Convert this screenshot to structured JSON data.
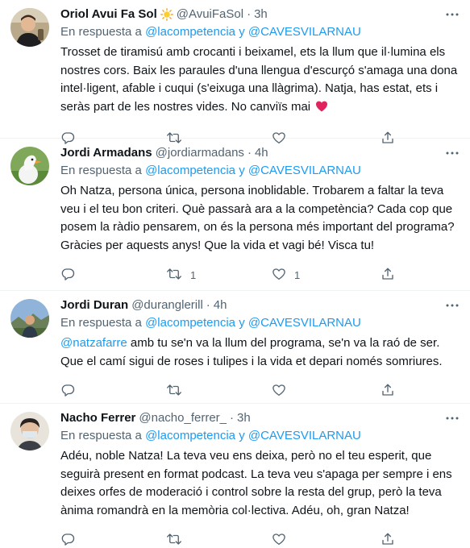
{
  "tweets": [
    {
      "name": "Oriol Avui Fa Sol",
      "has_sun": true,
      "handle": "@AvuiFaSol",
      "dot": "·",
      "time": "3h",
      "reply_prefix": "En respuesta a",
      "reply_link": "@lacompetencia y @CAVESVILARNAU",
      "mention": "",
      "text": "Trosset de tiramisú amb crocanti i beixamel, ets la llum que il·lumina els nostres cors. Baix les paraules d'una llengua d'escurçó s'amaga una dona intel·ligent, afable i cuqui (s'eixuga una llàgrima). Natja, has estat, ets i seràs part de les nostres vides. No canviïs mai",
      "ends_with_heart": true,
      "counts": {
        "reply": "",
        "retweet": "",
        "like": ""
      }
    },
    {
      "name": "Jordi Armadans",
      "has_sun": false,
      "handle": "@jordiarmadans",
      "dot": "·",
      "time": "4h",
      "reply_prefix": "En respuesta a",
      "reply_link": "@lacompetencia y @CAVESVILARNAU",
      "mention": "",
      "text": "Oh Natza, persona única, persona inoblidable. Trobarem a faltar la teva veu i el teu bon criteri. Què passarà ara a la competència? Cada cop que posem la ràdio pensarem, on és la persona més important del programa? Gràcies per aquests anys! Que la vida et vagi bé! Visca tu!",
      "ends_with_heart": false,
      "counts": {
        "reply": "",
        "retweet": "1",
        "like": "1"
      }
    },
    {
      "name": "Jordi Duran",
      "has_sun": false,
      "handle": "@duranglerill",
      "dot": "·",
      "time": "4h",
      "reply_prefix": "En respuesta a",
      "reply_link": "@lacompetencia y @CAVESVILARNAU",
      "mention": "@natzafarre",
      "text": " amb tu se'n va la llum del programa, se'n va la raó de ser. Que el camí sigui de roses i tulipes i la vida et depari només somriures.",
      "ends_with_heart": false,
      "counts": {
        "reply": "",
        "retweet": "",
        "like": ""
      }
    },
    {
      "name": "Nacho Ferrer",
      "has_sun": false,
      "handle": "@nacho_ferrer_",
      "dot": "·",
      "time": "3h",
      "reply_prefix": "En respuesta a",
      "reply_link": "@lacompetencia y @CAVESVILARNAU",
      "mention": "",
      "text": "Adéu, noble Natza! La teva veu ens deixa, però no el teu esperit, que seguirà present en format podcast. La teva veu s'apaga per sempre i ens deixes orfes de moderació i control sobre la resta del grup, però la teva ànima romandrà en la memòria col·lectiva. Adéu, oh, gran Natza!",
      "ends_with_heart": false,
      "counts": {
        "reply": "",
        "retweet": "",
        "like": ""
      }
    }
  ],
  "colors": {
    "text": "#0f1419",
    "secondary": "#536471",
    "link": "#1d9bf0",
    "divider": "#eff3f4",
    "heart_emoji": "#e0245e"
  },
  "icons": [
    "more-icon",
    "reply-icon",
    "retweet-icon",
    "like-icon",
    "share-icon",
    "sun-icon",
    "heart-emoji-icon"
  ]
}
